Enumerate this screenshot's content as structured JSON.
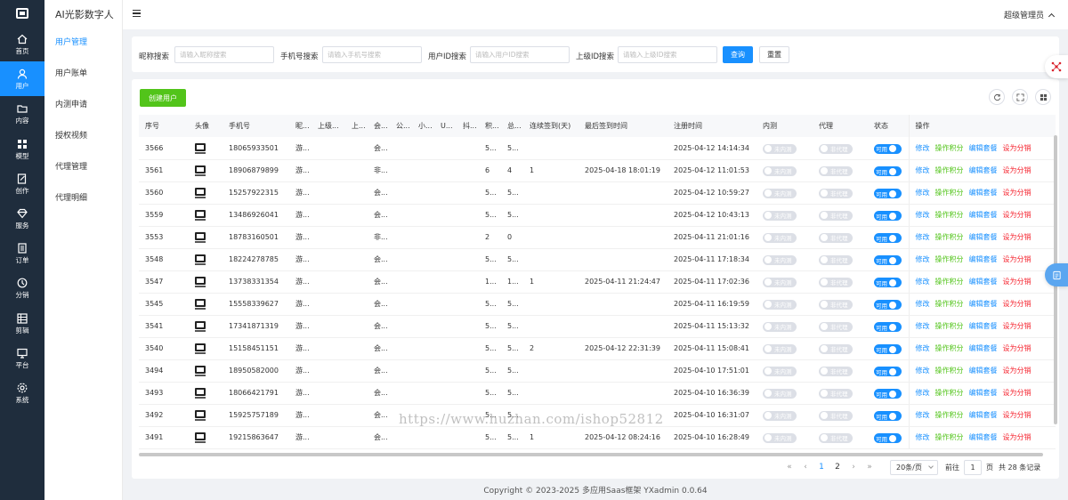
{
  "app": {
    "title": "AI光影数字人",
    "footer": "Copyright © 2023-2025 多应用Saas框架  YXadmin 0.0.64"
  },
  "rail": [
    {
      "label": "首页",
      "icon": "home-icon"
    },
    {
      "label": "用户",
      "icon": "user-icon",
      "active": true
    },
    {
      "label": "内容",
      "icon": "folder-icon"
    },
    {
      "label": "模型",
      "icon": "grid-icon"
    },
    {
      "label": "创作",
      "icon": "edit-icon"
    },
    {
      "label": "服务",
      "icon": "diamond-icon"
    },
    {
      "label": "订单",
      "icon": "list-icon"
    },
    {
      "label": "分销",
      "icon": "share-icon"
    },
    {
      "label": "剪辑",
      "icon": "table-icon"
    },
    {
      "label": "平台",
      "icon": "monitor-icon"
    },
    {
      "label": "系统",
      "icon": "settings-icon"
    }
  ],
  "submenu": [
    {
      "label": "用户管理",
      "active": true
    },
    {
      "label": "用户账单"
    },
    {
      "label": "内测申请"
    },
    {
      "label": "授权视频"
    },
    {
      "label": "代理管理"
    },
    {
      "label": "代理明细"
    }
  ],
  "header": {
    "user": "超级管理员"
  },
  "filter": {
    "nickname_label": "昵称搜索",
    "nickname_placeholder": "请输入昵称搜索",
    "phone_label": "手机号搜索",
    "phone_placeholder": "请输入手机号搜索",
    "uid_label": "用户ID搜索",
    "uid_placeholder": "请输入用户ID搜索",
    "pid_label": "上级ID搜索",
    "pid_placeholder": "请输入上级ID搜索",
    "query": "查询",
    "reset": "重置"
  },
  "toolbar": {
    "create": "创建用户"
  },
  "table": {
    "headers": [
      "序号",
      "头像",
      "手机号",
      "昵...",
      "上级...",
      "上...",
      "会...",
      "公...",
      "小...",
      "U...",
      "抖...",
      "积...",
      "总...",
      "连续签到(天)",
      "最后签到时间",
      "注册时间",
      "内测",
      "代理",
      "状态",
      "操作"
    ],
    "rows": [
      {
        "id": "3566",
        "phone": "18065933501",
        "nick": "游...",
        "c1": "",
        "c2": "",
        "vip": "会...",
        "p1": "",
        "p2": "",
        "p3": "",
        "p4": "",
        "points": "5...",
        "total": "5...",
        "streak": "",
        "last": "",
        "reg": "2025-04-12 14:14:34"
      },
      {
        "id": "3561",
        "phone": "18906879899",
        "nick": "游...",
        "c1": "",
        "c2": "",
        "vip": "非...",
        "p1": "",
        "p2": "",
        "p3": "",
        "p4": "",
        "points": "6",
        "total": "4",
        "streak": "1",
        "last": "2025-04-18 18:01:19",
        "reg": "2025-04-12 11:01:53"
      },
      {
        "id": "3560",
        "phone": "15257922315",
        "nick": "游...",
        "c1": "",
        "c2": "",
        "vip": "会...",
        "p1": "",
        "p2": "",
        "p3": "",
        "p4": "",
        "points": "5...",
        "total": "5...",
        "streak": "",
        "last": "",
        "reg": "2025-04-12 10:59:27"
      },
      {
        "id": "3559",
        "phone": "13486926041",
        "nick": "游...",
        "c1": "",
        "c2": "",
        "vip": "会...",
        "p1": "",
        "p2": "",
        "p3": "",
        "p4": "",
        "points": "5...",
        "total": "5...",
        "streak": "",
        "last": "",
        "reg": "2025-04-12 10:43:13"
      },
      {
        "id": "3553",
        "phone": "18783160501",
        "nick": "游...",
        "c1": "",
        "c2": "",
        "vip": "非...",
        "p1": "",
        "p2": "",
        "p3": "",
        "p4": "",
        "points": "2",
        "total": "0",
        "streak": "",
        "last": "",
        "reg": "2025-04-11 21:01:16"
      },
      {
        "id": "3548",
        "phone": "18224278785",
        "nick": "游...",
        "c1": "",
        "c2": "",
        "vip": "会...",
        "p1": "",
        "p2": "",
        "p3": "",
        "p4": "",
        "points": "5...",
        "total": "5...",
        "streak": "",
        "last": "",
        "reg": "2025-04-11 17:18:34"
      },
      {
        "id": "3547",
        "phone": "13738331354",
        "nick": "游...",
        "c1": "",
        "c2": "",
        "vip": "会...",
        "p1": "",
        "p2": "",
        "p3": "",
        "p4": "",
        "points": "1...",
        "total": "1...",
        "streak": "1",
        "last": "2025-04-11 21:24:47",
        "reg": "2025-04-11 17:02:36"
      },
      {
        "id": "3545",
        "phone": "15558339627",
        "nick": "游...",
        "c1": "",
        "c2": "",
        "vip": "会...",
        "p1": "",
        "p2": "",
        "p3": "",
        "p4": "",
        "points": "5...",
        "total": "5...",
        "streak": "",
        "last": "",
        "reg": "2025-04-11 16:19:59"
      },
      {
        "id": "3541",
        "phone": "17341871319",
        "nick": "游...",
        "c1": "",
        "c2": "",
        "vip": "会...",
        "p1": "",
        "p2": "",
        "p3": "",
        "p4": "",
        "points": "5...",
        "total": "5...",
        "streak": "",
        "last": "",
        "reg": "2025-04-11 15:13:32"
      },
      {
        "id": "3540",
        "phone": "15158451151",
        "nick": "游...",
        "c1": "",
        "c2": "",
        "vip": "会...",
        "p1": "",
        "p2": "",
        "p3": "",
        "p4": "",
        "points": "5...",
        "total": "5...",
        "streak": "2",
        "last": "2025-04-12 22:31:39",
        "reg": "2025-04-11 15:08:41"
      },
      {
        "id": "3494",
        "phone": "18950582000",
        "nick": "游...",
        "c1": "",
        "c2": "",
        "vip": "会...",
        "p1": "",
        "p2": "",
        "p3": "",
        "p4": "",
        "points": "5...",
        "total": "5...",
        "streak": "",
        "last": "",
        "reg": "2025-04-10 17:51:01"
      },
      {
        "id": "3493",
        "phone": "18066421791",
        "nick": "游...",
        "c1": "",
        "c2": "",
        "vip": "会...",
        "p1": "",
        "p2": "",
        "p3": "",
        "p4": "",
        "points": "5...",
        "total": "5...",
        "streak": "",
        "last": "",
        "reg": "2025-04-10 16:36:39"
      },
      {
        "id": "3492",
        "phone": "15925757189",
        "nick": "游...",
        "c1": "",
        "c2": "",
        "vip": "会...",
        "p1": "",
        "p2": "",
        "p3": "",
        "p4": "",
        "points": "5...",
        "total": "5...",
        "streak": "",
        "last": "",
        "reg": "2025-04-10 16:31:07"
      },
      {
        "id": "3491",
        "phone": "19215863647",
        "nick": "游...",
        "c1": "",
        "c2": "",
        "vip": "会...",
        "p1": "",
        "p2": "",
        "p3": "",
        "p4": "",
        "points": "5...",
        "total": "5...",
        "streak": "1",
        "last": "2025-04-12 08:24:16",
        "reg": "2025-04-10 16:28:49"
      }
    ],
    "beta_label": "未内测",
    "agent_label": "非代理",
    "status_label": "可用",
    "actions": [
      "修改",
      "操作积分",
      "编辑套餐",
      "设为分销"
    ]
  },
  "pagination": {
    "pages": [
      "1",
      "2"
    ],
    "page_size": "20条/页",
    "goto_label": "前往",
    "goto_value": "1",
    "page_suffix": "页",
    "total": "共 28 条记录"
  },
  "watermark": "https://www.huzhan.com/ishop52812",
  "colors": {
    "primary": "#1890ff",
    "success": "#52c41a",
    "danger": "#f5222d",
    "rail": "#1f2d3d"
  }
}
